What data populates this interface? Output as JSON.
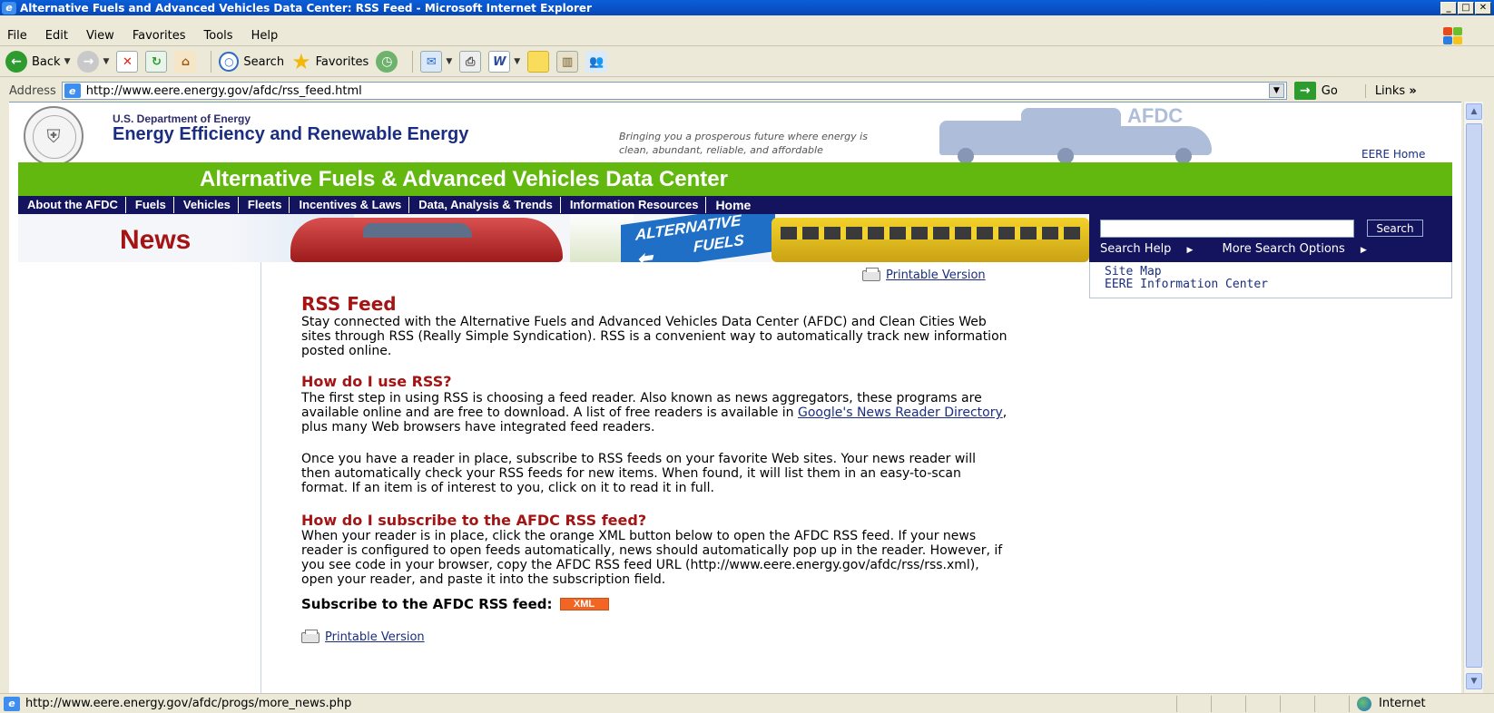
{
  "window": {
    "title": "Alternative Fuels and Advanced Vehicles Data Center: RSS Feed - Microsoft Internet Explorer",
    "controls": [
      "_",
      "□",
      "✕"
    ]
  },
  "menu": [
    "File",
    "Edit",
    "View",
    "Favorites",
    "Tools",
    "Help"
  ],
  "toolbar": {
    "back_label": "Back",
    "search_label": "Search",
    "favorites_label": "Favorites"
  },
  "address": {
    "label": "Address",
    "url": "http://www.eere.energy.gov/afdc/rss_feed.html",
    "go_label": "Go",
    "links_label": "Links"
  },
  "header": {
    "doe_name": "U.S. Department of Energy",
    "eere_name": "Energy Efficiency and Renewable Energy",
    "tagline_line1": "Bringing you a prosperous future where energy is",
    "tagline_line2": "clean, abundant, reliable, and affordable",
    "afdc_logo": "AFDC",
    "eere_home": "EERE Home",
    "site_title": "Alternative Fuels & Advanced Vehicles Data Center"
  },
  "nav": [
    "About the AFDC",
    "Fuels",
    "Vehicles",
    "Fleets",
    "Incentives & Laws",
    "Data, Analysis & Trends",
    "Information Resources",
    "Home"
  ],
  "banner": {
    "section": "News",
    "sign_line1": "ALTERNATIVE",
    "sign_line2": "FUELS"
  },
  "search": {
    "input_value": "",
    "button_label": "Search",
    "help_link": "Search Help",
    "more_options_link": "More Search Options"
  },
  "side_links": {
    "site_map": "Site Map",
    "info_center": "EERE Information Center"
  },
  "content": {
    "printable_label": "Printable Version",
    "title": "RSS Feed",
    "intro_lines": [
      "Stay connected with the Alternative Fuels and Advanced Vehicles Data Center (AFDC) and Clean Cities Web",
      "sites through RSS (Really Simple Syndication). RSS is a convenient way to automatically track new information",
      "posted online."
    ],
    "h_use": "How do I use RSS?",
    "use_line1": "The first step in using RSS is choosing a feed reader. Also known as news aggregators, these programs are",
    "use_line2_pre": "available online and are free to download. A list of free readers is available in ",
    "use_line2_link": "Google's News Reader Directory",
    "use_line2_post": ",",
    "use_line3": "plus many Web browsers have integrated feed readers.",
    "reader_lines": [
      "Once you have a reader in place, subscribe to RSS feeds on your favorite Web sites. Your news reader will",
      "then automatically check your RSS feeds for new items. When found, it will list them in an easy-to-scan",
      "format. If an item is of interest to you, click on it to read it in full."
    ],
    "h_subscribe": "How do I subscribe to the AFDC RSS feed?",
    "subscribe_lines": [
      "When your reader is in place, click the orange XML button below to open the AFDC RSS feed. If your news",
      "reader is configured to open feeds automatically, news should automatically pop up in the reader. However, if",
      "you see code in your browser, copy the AFDC RSS feed URL (http://www.eere.energy.gov/afdc/rss/rss.xml),",
      "open your reader, and paste it into the subscription field."
    ],
    "subscribe_label": "Subscribe to the AFDC RSS feed:",
    "xml_badge": "XML"
  },
  "status": {
    "text": "http://www.eere.energy.gov/afdc/progs/more_news.php",
    "zone": "Internet"
  },
  "colors": {
    "accent_red": "#a41414",
    "green_bar": "#63b80f",
    "navy": "#14145e",
    "xml_orange": "#f26522",
    "link_blue": "#1a2d80"
  }
}
